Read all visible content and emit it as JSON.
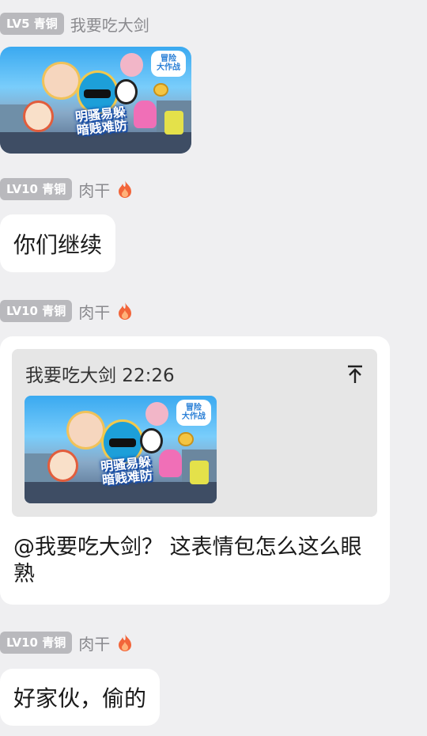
{
  "messages": [
    {
      "badge": "LV5 青铜",
      "name": "我要吃大剑",
      "image": {
        "logo": "冒险\n大作战",
        "title": "明骚易躲\n暗贱难防"
      }
    },
    {
      "badge": "LV10 青铜",
      "name": "肉干",
      "text": "你们继续"
    },
    {
      "badge": "LV10 青铜",
      "name": "肉干",
      "quote": {
        "author": "我要吃大剑 22:26",
        "image": {
          "logo": "冒险\n大作战",
          "title": "明骚易躲\n暗贱难防"
        }
      },
      "text": "@我要吃大剑？ 这表情包怎么这么眼熟"
    },
    {
      "badge": "LV10 青铜",
      "name": "肉干",
      "text": "好家伙，偷的"
    }
  ],
  "colors": {
    "background": "#efeff1",
    "badge": "#b9b9bd",
    "bubble": "#ffffff",
    "quote": "#e6e6e6",
    "flame": "#f2653a"
  },
  "icons": {
    "flame": "fire-icon",
    "quote_top": "arrow-up-to-top-icon"
  }
}
